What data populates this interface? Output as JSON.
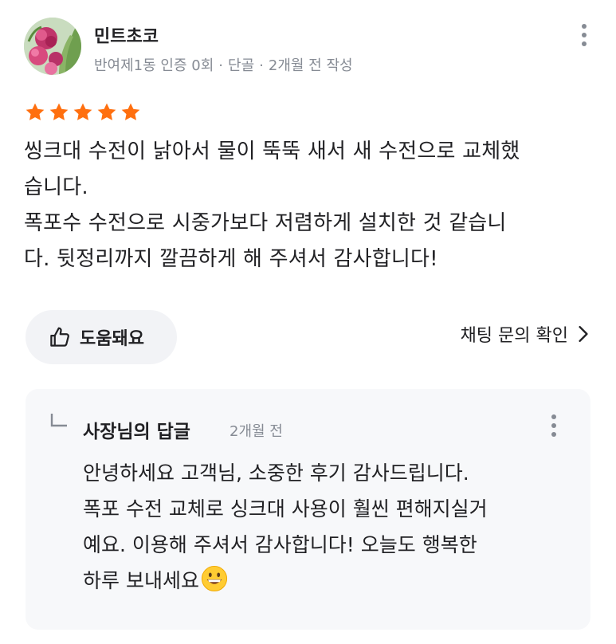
{
  "review": {
    "author": "민트초코",
    "meta": {
      "location": "반여제1동 인증 0회",
      "regular": "단골",
      "time": "2개월 전 작성"
    },
    "rating": 5,
    "body_lines": [
      "씽크대 수전이 낡아서 물이 뚝뚝 새서 새 수전으로 교체했",
      "습니다.",
      "폭포수 수전으로 시중가보다 저렴하게 설치한 것 같습니",
      "다. 뒷정리까지 깔끔하게 해 주셔서 감사합니다!"
    ],
    "helpful_label": "도움돼요",
    "chat_link_label": "채팅 문의 확인"
  },
  "reply": {
    "owner_label": "사장님의 답글",
    "time": "2개월 전",
    "lines": [
      "안녕하세요 고객님, 소중한 후기 감사드립니다.",
      "폭포 수전 교체로 싱크대 사용이 훨씬 편해지실거",
      "예요. 이용해 주셔서 감사합니다! 오늘도 행복한",
      "하루 보내세요"
    ]
  },
  "colors": {
    "star": "#ff6f0f",
    "meta_text": "#868b94",
    "helpful_bg": "#f2f3f6",
    "reply_bg": "#f7f8fa"
  },
  "icons": [
    "more-vertical-icon",
    "star-icon",
    "thumbs-up-icon",
    "chevron-right-icon",
    "reply-corner-icon",
    "grinning-face-emoji"
  ]
}
